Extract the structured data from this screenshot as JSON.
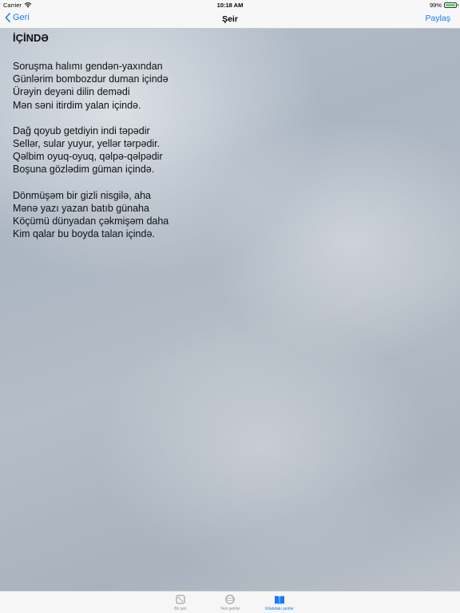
{
  "status_bar": {
    "carrier": "Carrier",
    "time": "10:18 AM",
    "battery": "99%"
  },
  "nav": {
    "back_label": "Geri",
    "title": "Şeir",
    "share_label": "Paylaş"
  },
  "poem": {
    "title": "İÇİNDƏ",
    "stanzas": [
      [
        "Soruşma halımı gendən-yaxından",
        "Günlərim bombozdur duman içində",
        "Ürəyin deyəni dilin demədi",
        "Mən səni itirdim yalan içində."
      ],
      [
        "Dağ qoyub getdiyin indi təpədir",
        "Sellər, sular yuyur, yellər tərpədir.",
        "Qəlbim oyuq-oyuq, qəlpə-qəlpədir",
        "Boşuna gözlədim güman içində."
      ],
      [
        "Dönmüşəm bir gizli nisgilə, aha",
        "Mənə yazı yazan batıb günaha",
        "Köçümü dünyadan çəkmişəm daha",
        "Kim qalar bu boyda talan içində."
      ]
    ]
  },
  "tabs": [
    {
      "label": "Bir şeir",
      "icon": "dice-icon"
    },
    {
      "label": "Yeni şeirlər",
      "icon": "new-badge-icon"
    },
    {
      "label": "Kitabdakı şeirlər",
      "icon": "book-icon"
    }
  ],
  "colors": {
    "accent": "#1a7cf5",
    "inactive": "#8e8e93"
  }
}
